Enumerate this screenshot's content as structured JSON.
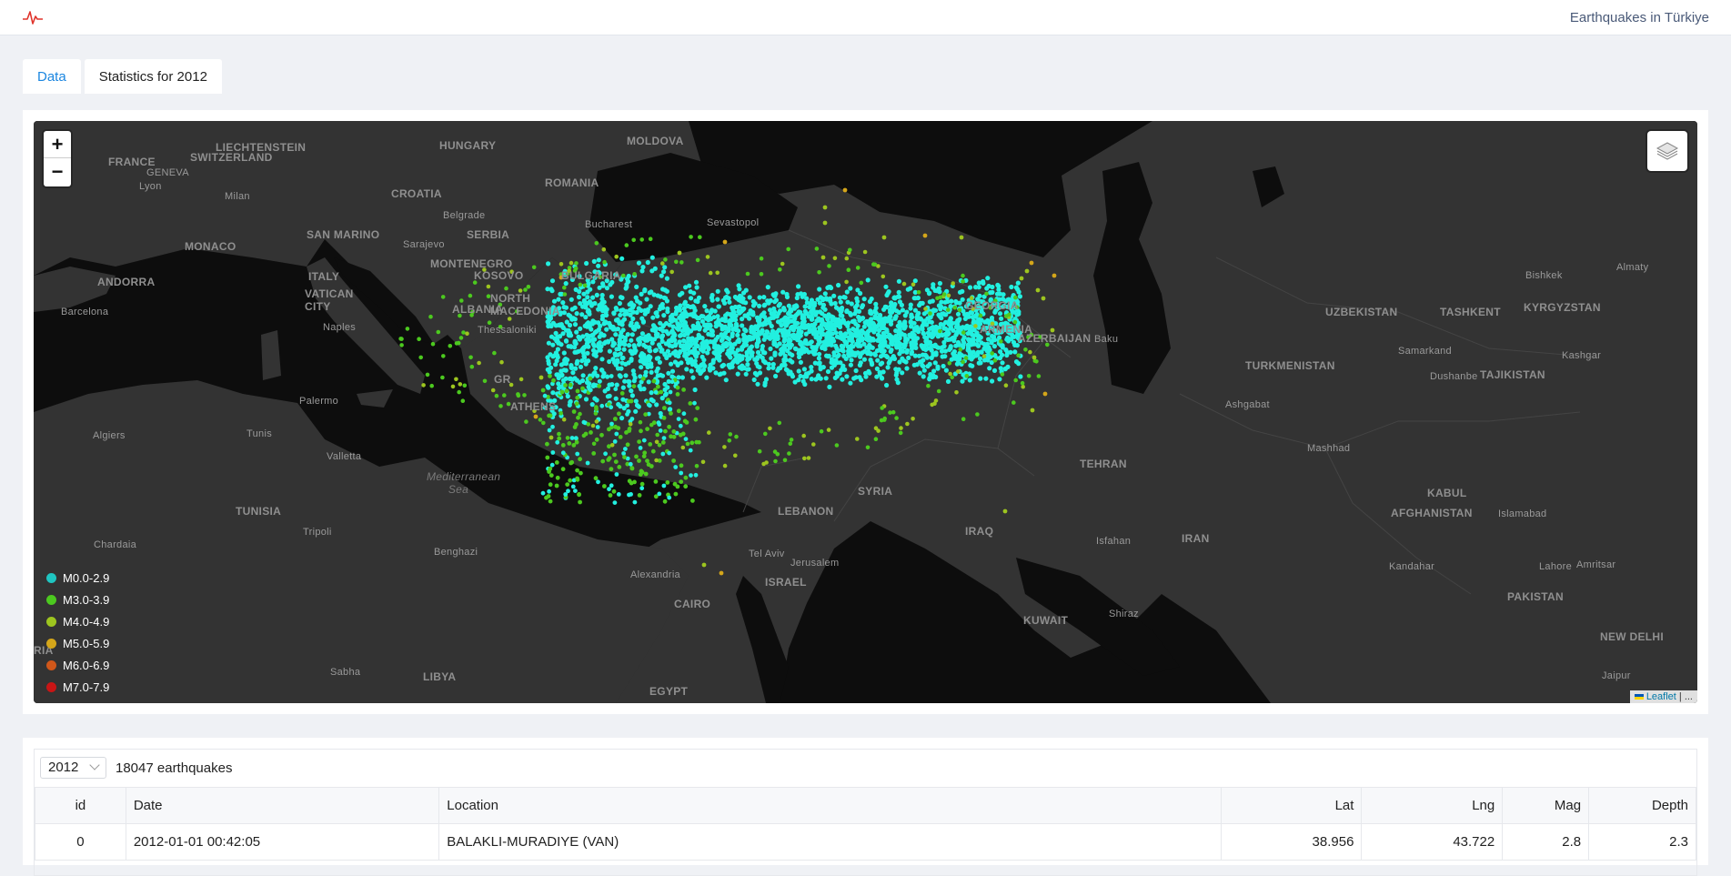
{
  "header": {
    "title": "Earthquakes in Türkiye"
  },
  "tabs": [
    {
      "label": "Data"
    },
    {
      "label": "Statistics for 2012"
    }
  ],
  "map": {
    "zoom_in": "+",
    "zoom_out": "−",
    "attribution_link": "Leaflet",
    "attribution_rest": "| ...",
    "legend": [
      {
        "label": "M0.0-2.9",
        "color": "#1fc5c1"
      },
      {
        "label": "M3.0-3.9",
        "color": "#4cc91f"
      },
      {
        "label": "M4.0-4.9",
        "color": "#9dc51f"
      },
      {
        "label": "M5.0-5.9",
        "color": "#d4a61a"
      },
      {
        "label": "M6.0-6.9",
        "color": "#d0571a"
      },
      {
        "label": "M7.0-7.9",
        "color": "#c81515"
      }
    ],
    "labels": {
      "france": "FRANCE",
      "liechtenstein": "LIECHTENSTEIN",
      "switzerland": "SWITZERLAND",
      "hungary": "HUNGARY",
      "moldova": "MOLDOVA",
      "romania": "ROMANIA",
      "croatia": "CROATIA",
      "geneva": "GENEVA",
      "lyon": "Lyon",
      "milan": "Milan",
      "monaco": "MONACO",
      "san_marino": "SAN MARINO",
      "sarajevo": "Sarajevo",
      "montenegro": "MONTENEGRO",
      "kosovo": "KOSOVO",
      "serbia": "SERBIA",
      "belgrade": "Belgrade",
      "bucharest": "Bucharest",
      "sevastopol": "Sevastopol",
      "bulgaria": "BULGARIA",
      "north_macedonia": "NORTH MACEDONIA",
      "albania": "ALBANIA",
      "thessaloniki": "Thessaloniki",
      "andorra": "ANDORRA",
      "barcelona": "Barcelona",
      "italy": "ITALY",
      "vatican": "VATICAN CITY",
      "naples": "Naples",
      "palermo": "Palermo",
      "algiers": "Algiers",
      "tunis": "Tunis",
      "valletta": "Valletta",
      "athens": "ATHENS",
      "gr": "GR",
      "med_sea": "Mediterranean Sea",
      "tunisia": "TUNISIA",
      "tripoli": "Tripoli",
      "chardaia": "Chardaia",
      "benghazi": "Benghazi",
      "libya": "LIBYA",
      "sabha": "Sabha",
      "egypt": "EGYPT",
      "alexandria": "Alexandria",
      "cairo": "CAIRO",
      "israel": "ISRAEL",
      "tel_aviv": "Tel Aviv",
      "jerusalem": "Jerusalem",
      "lebanon": "LEBANON",
      "syria": "SYRIA",
      "iraq": "IRAQ",
      "iran": "IRAN",
      "tehran": "TEHRAN",
      "kuwait": "KUWAIT",
      "shiraz": "Shiraz",
      "isfahan": "Isfahan",
      "georgia": "GEORGIA",
      "armenia": "ARMENIA",
      "azerbaijan": "AZERBAIJAN",
      "baku": "Baku",
      "turkmenistan": "TURKMENISTAN",
      "ashgabat": "Ashgabat",
      "mashhad": "Mashhad",
      "uzbekistan": "UZBEKISTAN",
      "tashkent": "TASHKENT",
      "kyrgyzstan": "KYRGYZSTAN",
      "bishkek": "Bishkek",
      "almaty": "Almaty",
      "samarkand": "Samarkand",
      "dushanbe": "Dushanbe",
      "tajikistan": "TAJIKISTAN",
      "kashgar": "Kashgar",
      "afghanistan": "AFGHANISTAN",
      "kabul": "KABUL",
      "islamabad": "Islamabad",
      "kandahar": "Kandahar",
      "pakistan": "PAKISTAN",
      "lahore": "Lahore",
      "amritsar": "Amritsar",
      "new_delhi": "NEW DELHI",
      "jaipur": "Jaipur",
      "ria": "RIA"
    }
  },
  "table": {
    "year": "2012",
    "count_text": "18047 earthquakes",
    "columns": [
      "id",
      "Date",
      "Location",
      "Lat",
      "Lng",
      "Mag",
      "Depth"
    ],
    "rows": [
      {
        "id": "0",
        "date": "2012-01-01 00:42:05",
        "location": "BALAKLI-MURADIYE (VAN)",
        "lat": "38.956",
        "lng": "43.722",
        "mag": "2.8",
        "depth": "2.3"
      }
    ]
  }
}
